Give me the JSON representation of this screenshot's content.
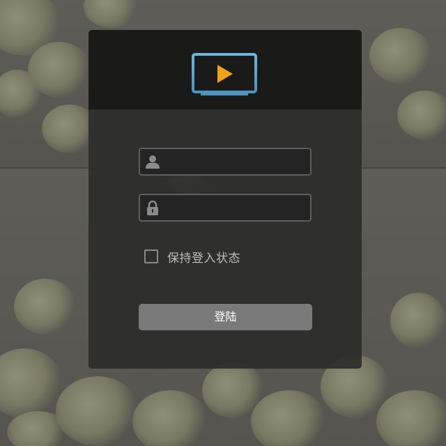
{
  "app": {
    "logo_icon": "tv-play-icon"
  },
  "login": {
    "username": {
      "icon": "user-icon",
      "value": "",
      "placeholder": ""
    },
    "password": {
      "icon": "lock-icon",
      "value": "",
      "placeholder": ""
    },
    "remember": {
      "label": "保持登入状态",
      "checked": false
    },
    "submit_label": "登陆"
  },
  "colors": {
    "logo_screen": "#5aa5cc",
    "logo_play": "#f0a21a",
    "panel": "#2c2c2b",
    "header": "#1a1a19",
    "button": "#7a7a7a"
  }
}
